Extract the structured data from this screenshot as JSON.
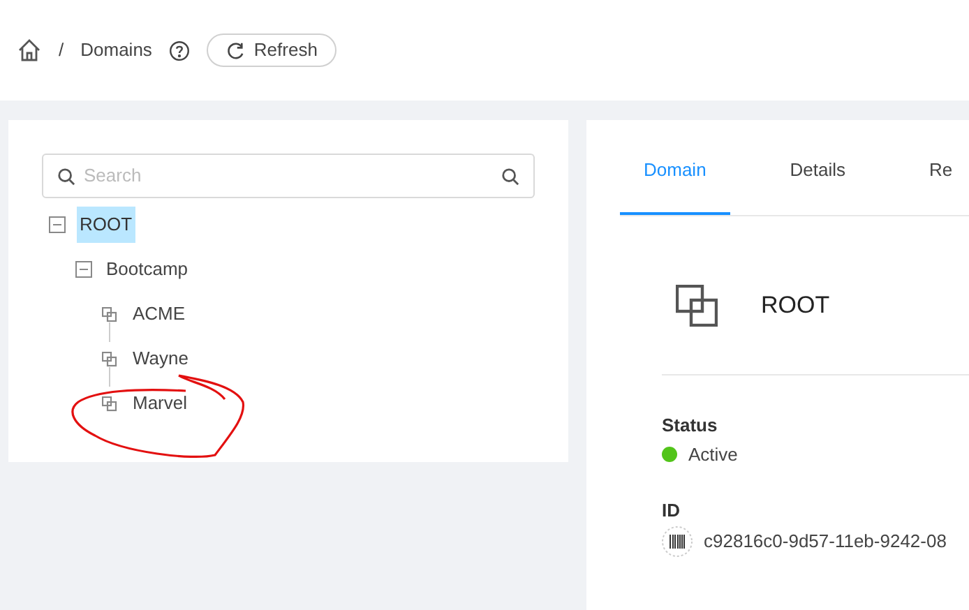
{
  "breadcrumb": {
    "items": [
      "/",
      "Domains"
    ],
    "refresh": "Refresh"
  },
  "search": {
    "placeholder": "Search"
  },
  "tree": [
    {
      "label": "ROOT",
      "kind": "folder",
      "expanded": true,
      "selected": true,
      "children": [
        {
          "label": "Bootcamp",
          "kind": "folder",
          "expanded": true,
          "selected": false,
          "children": [
            {
              "label": "ACME",
              "kind": "leaf",
              "selected": false
            },
            {
              "label": "Wayne",
              "kind": "leaf",
              "selected": false
            },
            {
              "label": "Marvel",
              "kind": "leaf",
              "selected": false
            }
          ]
        }
      ]
    }
  ],
  "tabs": [
    {
      "label": "Domain",
      "selected": true
    },
    {
      "label": "Details",
      "selected": false
    },
    {
      "label": "Re",
      "selected": false
    }
  ],
  "detail": {
    "title": "ROOT",
    "fields": [
      {
        "kind": "status",
        "label": "Status",
        "value": "Active",
        "color": "#52c41a"
      },
      {
        "kind": "id",
        "label": "ID",
        "value": "c92816c0-9d57-11eb-9242-08"
      }
    ]
  }
}
